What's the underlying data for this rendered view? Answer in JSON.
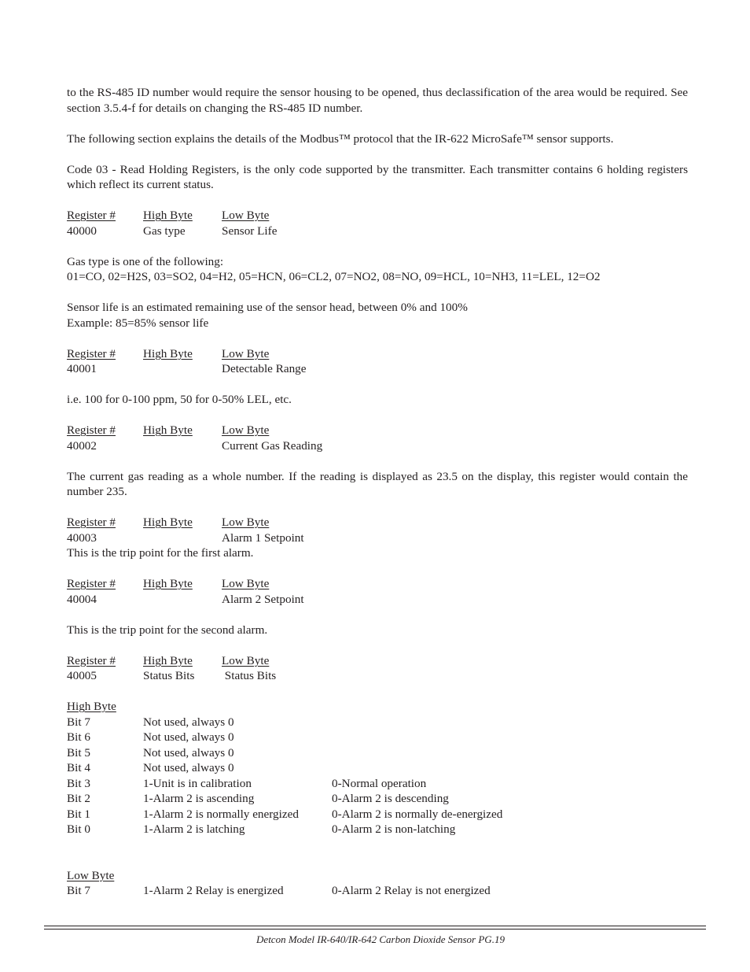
{
  "intro": {
    "para1": "to the RS-485 ID number would require the sensor housing to be opened, thus declassification of the area would be required. See section 3.5.4-f for details on changing the RS-485 ID number.",
    "para2": "The following section explains the details of the Modbus™ protocol that the IR-622 MicroSafe™ sensor supports.",
    "para3": "Code 03 - Read Holding Registers, is the only code supported by the transmitter. Each transmitter contains 6 holding registers which reflect its current status."
  },
  "table_header": {
    "register": "Register #",
    "high_byte": "High Byte",
    "low_byte": "Low Byte"
  },
  "registers": [
    {
      "number": "40000",
      "high": "Gas type",
      "low": "Sensor Life"
    },
    {
      "number": "40001",
      "high": "",
      "low": "Detectable Range"
    },
    {
      "number": "40002",
      "high": "",
      "low": "Current Gas Reading"
    },
    {
      "number": "40003",
      "high": "",
      "low": "Alarm 1 Setpoint"
    },
    {
      "number": "40004",
      "high": "",
      "low": "Alarm 2 Setpoint"
    },
    {
      "number": "40005",
      "high": "Status Bits",
      "low": " Status Bits"
    }
  ],
  "notes": {
    "gas_type_heading": "Gas type is one of the following:",
    "gas_type_list": "01=CO, 02=H2S, 03=SO2, 04=H2, 05=HCN, 06=CL2, 07=NO2, 08=NO, 09=HCL, 10=NH3, 11=LEL, 12=O2",
    "sensor_life": "Sensor life is an estimated remaining use of the sensor head, between 0% and 100%",
    "sensor_life_example": "Example:  85=85% sensor life",
    "range_example": "i.e. 100 for 0-100 ppm, 50 for 0-50% LEL, etc.",
    "gas_reading": "The current gas reading as a whole number. If the reading is displayed as 23.5 on the display, this register would contain the number 235.",
    "alarm1": "This is the trip point for the first alarm.",
    "alarm2": "This is the trip point for the second alarm."
  },
  "high_byte_bits": {
    "heading": "High Byte",
    "rows": [
      {
        "bit": "Bit 7",
        "one": "Not used, always 0",
        "zero": ""
      },
      {
        "bit": "Bit 6",
        "one": "Not used, always 0",
        "zero": ""
      },
      {
        "bit": "Bit 5",
        "one": "Not used, always 0",
        "zero": ""
      },
      {
        "bit": "Bit 4",
        "one": "Not used, always 0",
        "zero": ""
      },
      {
        "bit": "Bit 3",
        "one": "1-Unit is in calibration",
        "zero": "0-Normal operation"
      },
      {
        "bit": "Bit 2",
        "one": "1-Alarm 2 is ascending",
        "zero": "0-Alarm 2 is descending"
      },
      {
        "bit": "Bit 1",
        "one": "1-Alarm 2 is normally energized",
        "zero": "0-Alarm 2 is normally de-energized"
      },
      {
        "bit": "Bit 0",
        "one": "1-Alarm 2 is latching",
        "zero": "0-Alarm 2 is non-latching"
      }
    ]
  },
  "low_byte_bits": {
    "heading": "Low Byte",
    "rows": [
      {
        "bit": "Bit 7",
        "one": "1-Alarm 2 Relay is energized",
        "zero": "0-Alarm 2 Relay is not energized"
      }
    ]
  },
  "footer": {
    "text": "Detcon Model IR-640/IR-642 Carbon Dioxide Sensor  PG.19"
  }
}
